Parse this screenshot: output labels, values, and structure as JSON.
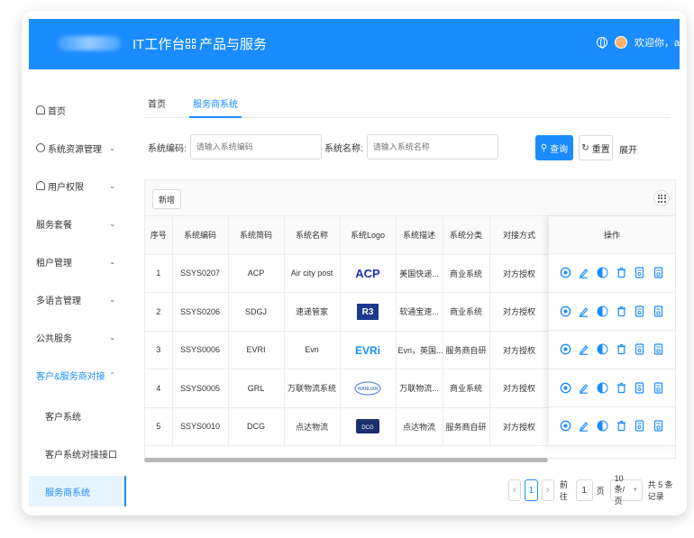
{
  "header": {
    "title": "IT工作台",
    "products": "产品与服务",
    "welcome": "欢迎你，a"
  },
  "sidebar": {
    "items": [
      {
        "label": "首页",
        "icon": "home-icon"
      },
      {
        "label": "系统资源管理",
        "icon": "gear-icon"
      },
      {
        "label": "用户权限",
        "icon": "user-icon"
      },
      {
        "label": "服务套餐"
      },
      {
        "label": "租户管理"
      },
      {
        "label": "多语言管理"
      },
      {
        "label": "公共服务"
      },
      {
        "label": "客户&服务商对接"
      },
      {
        "label": "客户系统"
      },
      {
        "label": "客户系统对接接口"
      },
      {
        "label": "服务商系统"
      }
    ]
  },
  "tabs": [
    "首页",
    "服务商系统"
  ],
  "filters": {
    "code_label": "系统编码:",
    "code_placeholder": "请输入系统编码",
    "name_label": "系统名称:",
    "name_placeholder": "请输入系统名称",
    "query": "查询",
    "reset": "重置",
    "expand": "展开"
  },
  "toolbar": {
    "add": "新增"
  },
  "table": {
    "headers": [
      "序号",
      "系统编码",
      "系统简码",
      "系统名称",
      "系统Logo",
      "系统描述",
      "系统分类",
      "对接方式"
    ],
    "ops_header": "操作",
    "rows": [
      {
        "no": "1",
        "code": "SSYS0207",
        "short": "ACP",
        "name": "Air city post",
        "logo": "ACP",
        "desc": "美国快递...",
        "category": "商业系统",
        "mode": "对方授权"
      },
      {
        "no": "2",
        "code": "SSYS0206",
        "short": "SDGJ",
        "name": "速递管家",
        "logo": "R3",
        "desc": "软通宝速...",
        "category": "商业系统",
        "mode": "对方授权"
      },
      {
        "no": "3",
        "code": "SSYS0006",
        "short": "EVRI",
        "name": "Evri",
        "logo": "EVRi",
        "desc": "Evri，英国...",
        "category": "服务商自研",
        "mode": "对方授权"
      },
      {
        "no": "4",
        "code": "SSYS0005",
        "short": "GRL",
        "name": "万联物流系统",
        "logo": "WANLIAN",
        "desc": "万联物流...",
        "category": "商业系统",
        "mode": "对方授权"
      },
      {
        "no": "5",
        "code": "SSYS0010",
        "short": "DCG",
        "name": "点达物流",
        "logo": "DCG",
        "desc": "点达物流",
        "category": "服务商自研",
        "mode": "对方授权"
      }
    ]
  },
  "pagination": {
    "current": "1",
    "goto_prefix": "前往",
    "goto_value": "1",
    "goto_suffix": "页",
    "page_size": "10条/页",
    "total": "共 5 条记录"
  },
  "colors": {
    "primary": "#1a8cff"
  }
}
